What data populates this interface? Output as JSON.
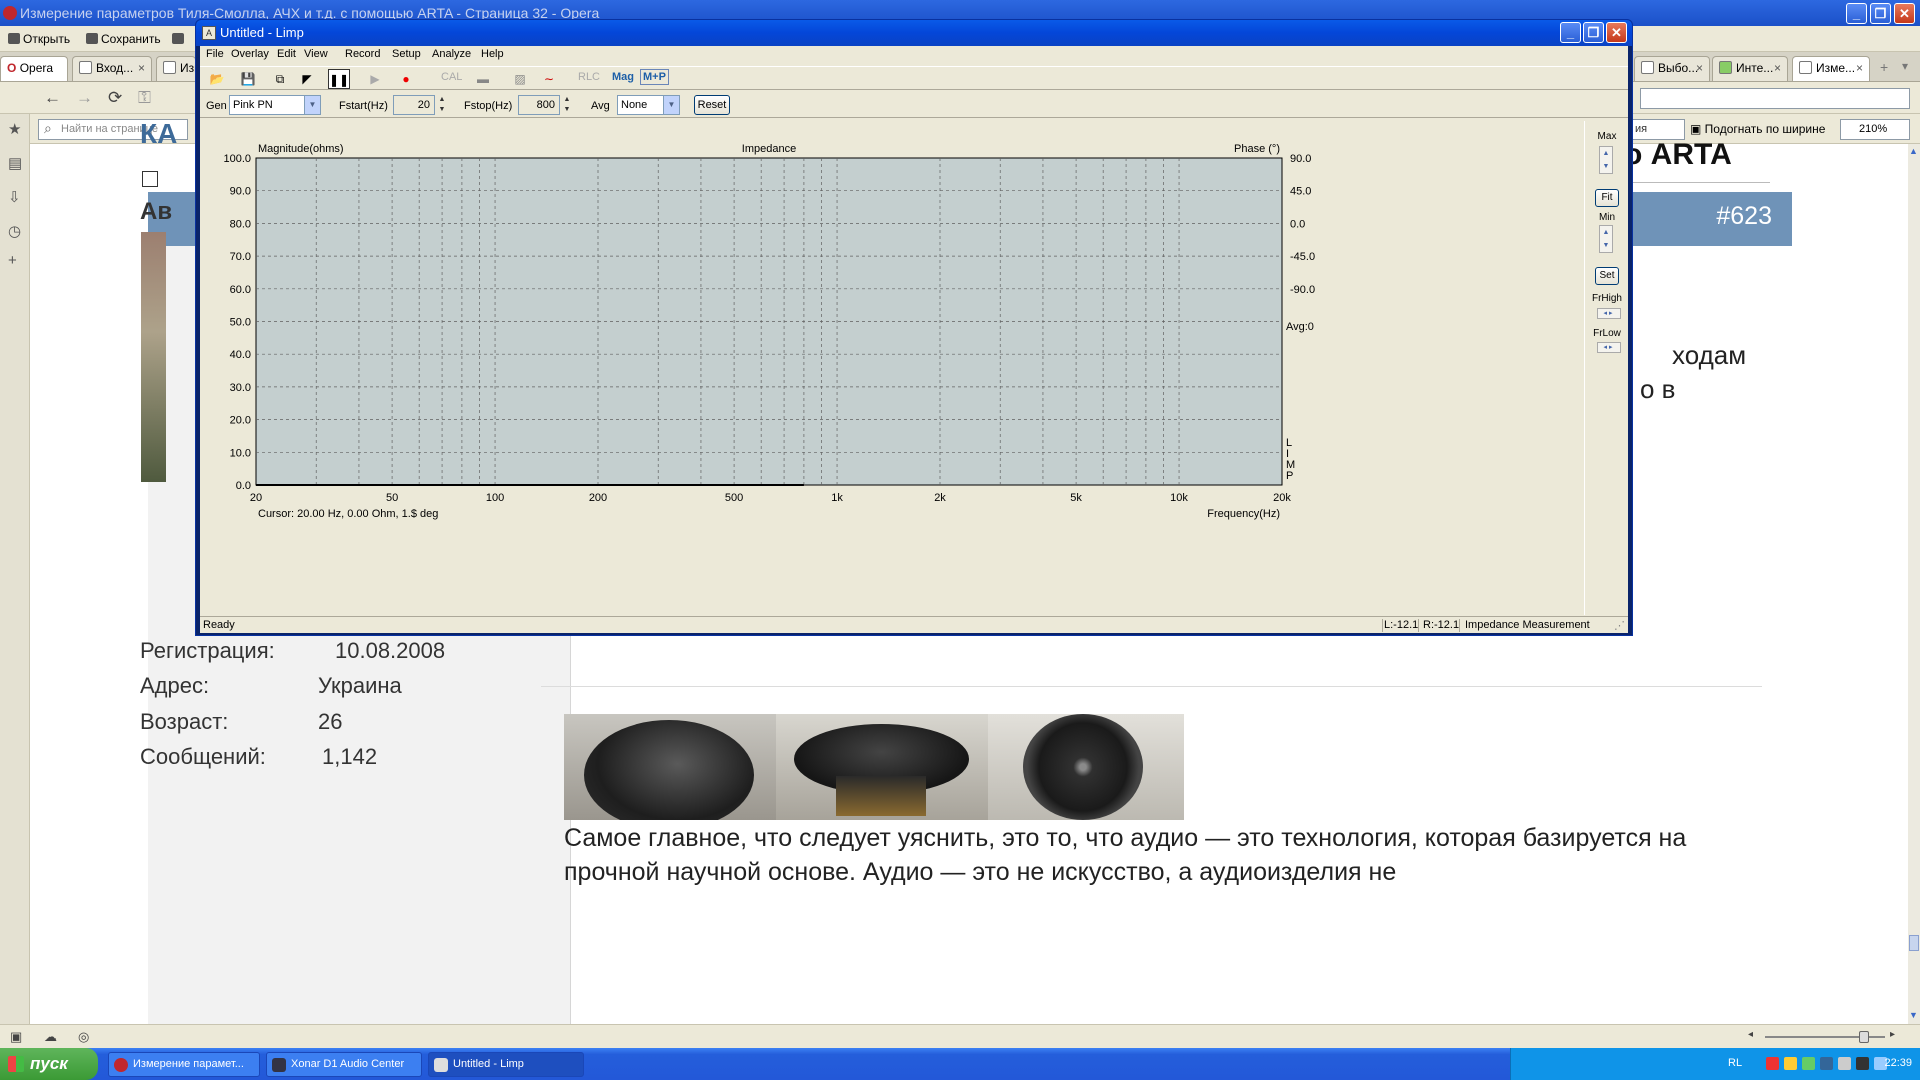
{
  "opera": {
    "window_title": "Измерение параметров Тиля-Смолла, АЧХ и т.д. с помощью ARTA - Страница 32 - Opera",
    "toolbar": {
      "open": "Открыть",
      "save": "Сохранить"
    },
    "tabs": [
      {
        "label": "Opera"
      },
      {
        "label": "Вход..."
      },
      {
        "label": "Изме"
      },
      {
        "label": "Выбо..."
      },
      {
        "label": "Инте..."
      },
      {
        "label": "Изме..."
      }
    ],
    "find_placeholder": "Найти на странице",
    "find_partial": "ия",
    "fit_width": "Подогнать по ширине",
    "zoom": "210%"
  },
  "page": {
    "post_number": "#623",
    "frag_ka": "КА",
    "frag_av": "Ав",
    "heading_frag": "о ARTA",
    "text_frag_1": "ходам",
    "text_frag_2": "о в",
    "user": {
      "reg_label": "Регистрация:",
      "reg_value": "10.08.2008",
      "addr_label": "Адрес:",
      "addr_value": "Украина",
      "age_label": "Возраст:",
      "age_value": "26",
      "posts_label": "Сообщений:",
      "posts_value": "1,142"
    },
    "article_text": "Самое главное, что следует уяснить, это то, что аудио — это технология, которая базируется на прочной научной основе. Аудио — это не искусство, а аудиоизделия не"
  },
  "limp": {
    "title": "Untitled - Limp",
    "menu": [
      "File",
      "Overlay",
      "Edit",
      "View",
      "Record",
      "Setup",
      "Analyze",
      "Help"
    ],
    "toolbar": {
      "cal": "CAL",
      "rlc": "RLC",
      "mag": "Mag",
      "mp": "M+P"
    },
    "controls": {
      "gen_label": "Gen",
      "gen_value": "Pink PN",
      "fstart_label": "Fstart(Hz)",
      "fstart_value": "20",
      "fstop_label": "Fstop(Hz)",
      "fstop_value": "800",
      "avg_label": "Avg",
      "avg_value": "None",
      "reset": "Reset"
    },
    "right_panel": {
      "max": "Max",
      "fit": "Fit",
      "min": "Min",
      "set": "Set",
      "frhigh": "FrHigh",
      "frlow": "FrLow"
    },
    "status": {
      "ready": "Ready",
      "l": "L:-12.1",
      "r": "R:-12.1",
      "mode": "Impedance Measurement"
    },
    "colors": {
      "plot_bg": "#c4cfcf",
      "grid": "#606060",
      "titlebar": "#0a5ae8"
    }
  },
  "chart_data": {
    "type": "line",
    "title": "Impedance",
    "ylabel": "Magnitude(ohms)",
    "y2label": "Phase (°)",
    "xlabel": "Frequency(Hz)",
    "xscale": "log",
    "xlim": [
      20,
      20000
    ],
    "ylim": [
      0,
      100
    ],
    "y2lim": [
      -90,
      90
    ],
    "grid": true,
    "x_ticks": [
      "20",
      "50",
      "100",
      "200",
      "500",
      "1k",
      "2k",
      "5k",
      "10k",
      "20k"
    ],
    "x_tick_values": [
      20,
      50,
      100,
      200,
      500,
      1000,
      2000,
      5000,
      10000,
      20000
    ],
    "y_ticks": [
      "0.0",
      "10.0",
      "20.0",
      "30.0",
      "40.0",
      "50.0",
      "60.0",
      "70.0",
      "80.0",
      "90.0",
      "100.0"
    ],
    "y2_ticks": [
      "90.0",
      "45.0",
      "0.0",
      "-45.0",
      "-90.0"
    ],
    "avg_label": "Avg:0",
    "side_label": [
      "L",
      "I",
      "M",
      "P"
    ],
    "cursor_text": "Cursor: 20.00 Hz, 0.00 Ohm, 1.$ deg",
    "series": [
      {
        "x": [
          20,
          800
        ],
        "values": [
          0,
          0
        ]
      }
    ]
  },
  "taskbar": {
    "start": "пуск",
    "tasks": [
      "Измерение парамет...",
      "Xonar D1 Audio Center",
      "Untitled - Limp"
    ],
    "lang": "RL",
    "clock": "22:39"
  }
}
